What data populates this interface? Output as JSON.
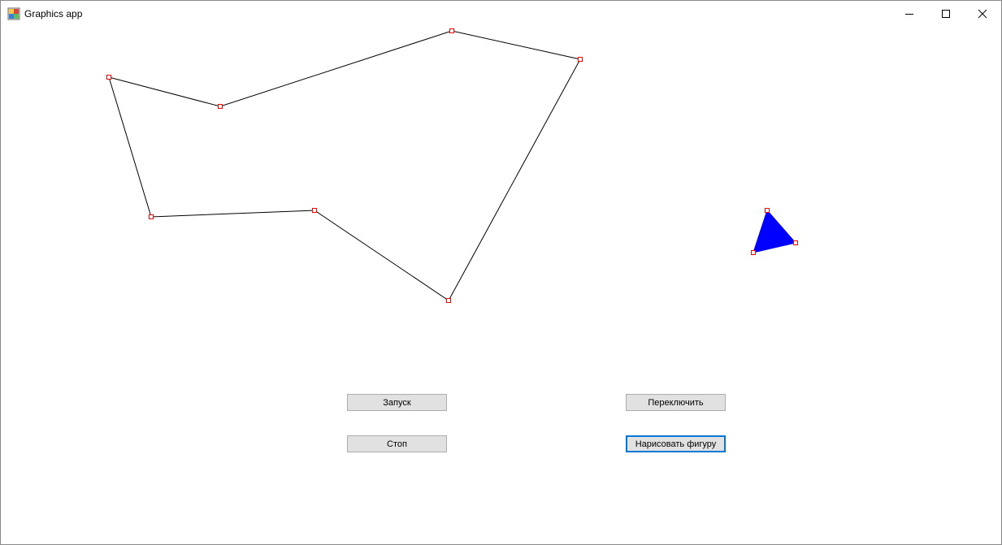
{
  "window": {
    "title": "Graphics app",
    "controls": {
      "minimize_icon": "minimize-icon",
      "maximize_icon": "maximize-icon",
      "close_icon": "close-icon"
    }
  },
  "canvas": {
    "stroke_color": "#000000",
    "vertex_marker_color": "#ff0000",
    "triangle_fill": "#0000ff"
  },
  "buttons": {
    "start_label": "Запуск",
    "stop_label": "Стоп",
    "switch_label": "Переключить",
    "draw_label": "Нарисовать фигуру"
  }
}
